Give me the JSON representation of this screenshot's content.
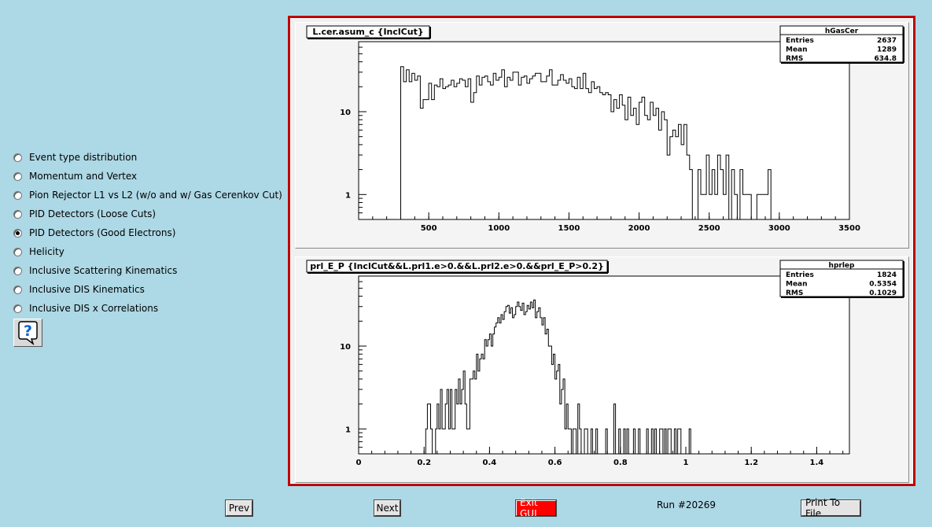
{
  "options": [
    {
      "label": "Event type distribution",
      "checked": false
    },
    {
      "label": "Momentum and Vertex",
      "checked": false
    },
    {
      "label": "Pion Rejector L1 vs L2 (w/o and w/ Gas Cerenkov Cut)",
      "checked": false
    },
    {
      "label": "PID Detectors (Loose Cuts)",
      "checked": false
    },
    {
      "label": "PID Detectors (Good Electrons)",
      "checked": true
    },
    {
      "label": "Helicity",
      "checked": false
    },
    {
      "label": "Inclusive Scattering Kinematics",
      "checked": false
    },
    {
      "label": "Inclusive DIS Kinematics",
      "checked": false
    },
    {
      "label": "Inclusive DIS x Correlations",
      "checked": false
    }
  ],
  "buttons": {
    "prev": "Prev",
    "next": "Next",
    "exit": "Exit GUI",
    "print": "Print To File"
  },
  "run_label": "Run #20269",
  "colors": {
    "background": "#add8e6",
    "canvas_border": "#c00000",
    "exit_button": "#ff0000"
  },
  "help_icon": "question-icon",
  "chart_data": [
    {
      "type": "bar",
      "title": "L.cer.asum_c {InclCut}",
      "stats": {
        "name": "hGasCer",
        "rows": [
          [
            "Entries",
            "2637"
          ],
          [
            "Mean",
            "1289"
          ],
          [
            "RMS",
            "634.8"
          ]
        ]
      },
      "xlim": [
        0,
        3500
      ],
      "x_ticks": [
        "500",
        "1000",
        "1500",
        "2000",
        "2500",
        "3000",
        "3500"
      ],
      "y_scale": "log",
      "y_ticks": [
        "1",
        "10"
      ],
      "ylim": [
        0.5,
        70
      ],
      "bin_width": 20,
      "x_start": 300,
      "values": [
        35,
        23,
        32,
        23,
        29,
        24,
        27,
        11,
        14,
        14,
        22,
        14,
        21,
        20,
        25,
        19,
        20,
        21,
        24,
        20,
        22,
        25,
        24,
        20,
        25,
        13,
        17,
        27,
        21,
        26,
        27,
        23,
        21,
        29,
        24,
        26,
        32,
        20,
        26,
        24,
        30,
        30,
        21,
        26,
        27,
        22,
        25,
        27,
        29,
        29,
        23,
        23,
        27,
        32,
        21,
        21,
        24,
        28,
        24,
        22,
        25,
        20,
        19,
        26,
        19,
        29,
        19,
        17,
        23,
        19,
        20,
        17,
        16,
        17,
        16,
        10,
        14,
        11,
        16,
        12,
        8,
        15,
        9,
        11,
        7,
        13,
        15,
        9,
        8,
        13,
        9,
        11,
        6,
        10,
        8,
        3,
        5,
        6,
        5,
        7,
        4,
        7,
        3,
        2,
        0.3,
        0.3,
        2,
        1,
        1,
        3,
        1,
        2,
        1,
        3,
        2,
        1,
        3,
        0.3,
        2,
        1,
        0.3,
        2,
        1,
        1,
        1,
        0.3,
        0.3,
        1,
        1,
        1,
        1,
        2
      ]
    },
    {
      "type": "bar",
      "title": "prl_E_P {InclCut&&L.prl1.e>0.&&L.prl2.e>0.&&prl_E_P>0.2}",
      "stats": {
        "name": "hprlep",
        "rows": [
          [
            "Entries",
            "1824"
          ],
          [
            "Mean",
            "0.5354"
          ],
          [
            "RMS",
            "0.1029"
          ]
        ]
      },
      "xlim": [
        0,
        1.5
      ],
      "x_ticks": [
        "0",
        "0.2",
        "0.4",
        "0.6",
        "0.8",
        "1",
        "1.2",
        "1.4"
      ],
      "y_scale": "log",
      "y_ticks": [
        "1",
        "10"
      ],
      "ylim": [
        0.5,
        70
      ],
      "bin_width": 0.005,
      "x_start": 0.2,
      "values": [
        0.3,
        1,
        2,
        2,
        1,
        0.3,
        0.3,
        1,
        2,
        1,
        3,
        1,
        1,
        2,
        3,
        1,
        3,
        1,
        1,
        3,
        2,
        4,
        2,
        3,
        5,
        2,
        1,
        1,
        4,
        4,
        5,
        4,
        8,
        5,
        7,
        8,
        7,
        12,
        10,
        12,
        14,
        10,
        14,
        17,
        19,
        22,
        19,
        24,
        21,
        26,
        30,
        31,
        25,
        29,
        22,
        24,
        30,
        34,
        30,
        27,
        33,
        24,
        26,
        31,
        28,
        34,
        29,
        36,
        22,
        26,
        29,
        22,
        18,
        22,
        14,
        16,
        10,
        10,
        6,
        8,
        4,
        5,
        6,
        2,
        3,
        4,
        1,
        2,
        1,
        1,
        0.3,
        1,
        1,
        0.3,
        2,
        1,
        0.3,
        0.3,
        1,
        1,
        0.3,
        0.3,
        1,
        0.3,
        0.3,
        1,
        0.3,
        0.3,
        0.3,
        0.3,
        0.3,
        1,
        0.3,
        0.3,
        0.3,
        0.3,
        2,
        0.3,
        0.3,
        1,
        0.3,
        0.3,
        1,
        0.3,
        1,
        0.3,
        0.3,
        0.3,
        1,
        0.3,
        0.3,
        1,
        0.3,
        0.3,
        0.3,
        0.3,
        1,
        0.3,
        0.3,
        1,
        0.3,
        1,
        0.3,
        0.3,
        1,
        1,
        0.3,
        1,
        0.3,
        1,
        1,
        0.3,
        0.3,
        1,
        0.3,
        1,
        1,
        0.3,
        0.3,
        0.3,
        0.3,
        0.3,
        1
      ]
    }
  ]
}
